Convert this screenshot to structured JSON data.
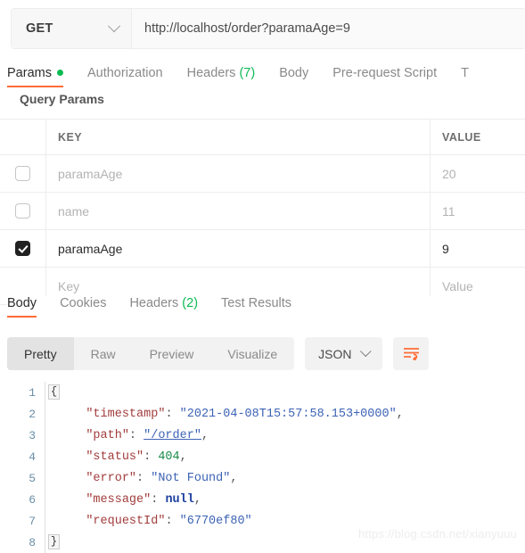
{
  "request": {
    "method": "GET",
    "url": "http://localhost/order?paramaAge=9",
    "method_caret": "chevron-down-icon"
  },
  "request_tabs": [
    {
      "label": "Params",
      "dot": true,
      "active": true
    },
    {
      "label": "Authorization",
      "dot": false,
      "active": false
    },
    {
      "label": "Headers",
      "count": "(7)",
      "dot": false,
      "active": false
    },
    {
      "label": "Body",
      "dot": false,
      "active": false
    },
    {
      "label": "Pre-request Script",
      "dot": false,
      "active": false
    },
    {
      "label": "T",
      "dot": false,
      "active": false
    }
  ],
  "params": {
    "section_title": "Query Params",
    "columns": {
      "key": "KEY",
      "value": "VALUE"
    },
    "rows": [
      {
        "checked": false,
        "key": "paramaAge",
        "value": "20",
        "disabled": true
      },
      {
        "checked": false,
        "key": "name",
        "value": "11",
        "disabled": true
      },
      {
        "checked": true,
        "key": "paramaAge",
        "value": "9",
        "disabled": false
      }
    ],
    "placeholder_row": {
      "key": "Key",
      "value": "Value"
    }
  },
  "response_tabs": [
    {
      "label": "Body",
      "active": true
    },
    {
      "label": "Cookies",
      "active": false
    },
    {
      "label": "Headers",
      "count": "(2)",
      "active": false
    },
    {
      "label": "Test Results",
      "active": false
    }
  ],
  "format_bar": {
    "segments": [
      {
        "label": "Pretty",
        "active": true
      },
      {
        "label": "Raw",
        "active": false
      },
      {
        "label": "Preview",
        "active": false
      },
      {
        "label": "Visualize",
        "active": false
      }
    ],
    "language": "JSON",
    "language_caret": "chevron-down-icon",
    "wrap_button": "wrap-lines-icon"
  },
  "response_body": {
    "line_numbers": [
      "1",
      "2",
      "3",
      "4",
      "5",
      "6",
      "7",
      "8"
    ],
    "open_brace": "{",
    "close_brace": "}",
    "fields": [
      {
        "key": "\"timestamp\"",
        "colon": ": ",
        "value": "\"2021-04-08T15:57:58.153+0000\"",
        "type": "string",
        "comma": ","
      },
      {
        "key": "\"path\"",
        "colon": ": ",
        "value": "\"/order\"",
        "type": "link",
        "comma": ","
      },
      {
        "key": "\"status\"",
        "colon": ": ",
        "value": "404",
        "type": "number",
        "comma": ","
      },
      {
        "key": "\"error\"",
        "colon": ": ",
        "value": "\"Not Found\"",
        "type": "string",
        "comma": ","
      },
      {
        "key": "\"message\"",
        "colon": ": ",
        "value": "null",
        "type": "null",
        "comma": ","
      },
      {
        "key": "\"requestId\"",
        "colon": ": ",
        "value": "\"6770ef80\"",
        "type": "string",
        "comma": ""
      }
    ]
  },
  "watermark": "https://blog.csdn.net/xianyuuu",
  "colors": {
    "accent": "#ff6c37",
    "green": "#0cbb52",
    "panel": "#f7f7f7",
    "border": "#ededed"
  }
}
